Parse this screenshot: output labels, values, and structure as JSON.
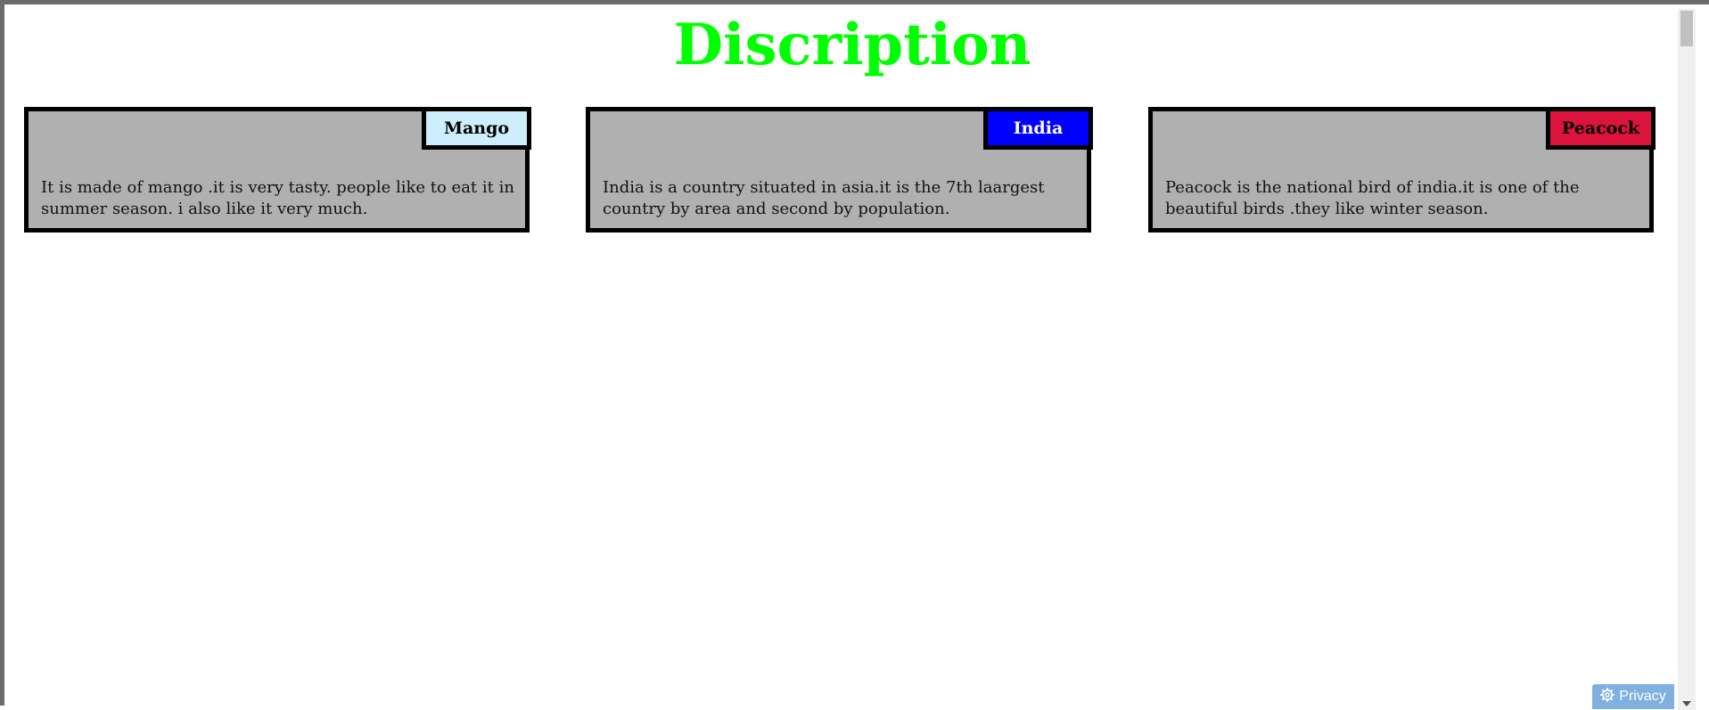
{
  "header": {
    "title": "Discription"
  },
  "cards": [
    {
      "badge": "Mango",
      "badge_color": "#cdeefc",
      "badge_text_color": "#000000",
      "text": "It is made of mango .it is very tasty. people like to eat it in summer season. i also like it very much."
    },
    {
      "badge": "India",
      "badge_color": "#0000ff",
      "badge_text_color": "#ffffff",
      "text": "India is a country situated in asia.it is the 7th laargest country by area and second by population."
    },
    {
      "badge": "Peacock",
      "badge_color": "#dc143c",
      "badge_text_color": "#000000",
      "text": "Peacock is the national bird of india.it is one of the beautiful birds .they like winter season."
    }
  ],
  "privacy": {
    "label": "Privacy",
    "icon": "gear-icon"
  },
  "colors": {
    "title": "#00ff00",
    "card_background": "#b0b0b0",
    "card_border": "#000000"
  }
}
